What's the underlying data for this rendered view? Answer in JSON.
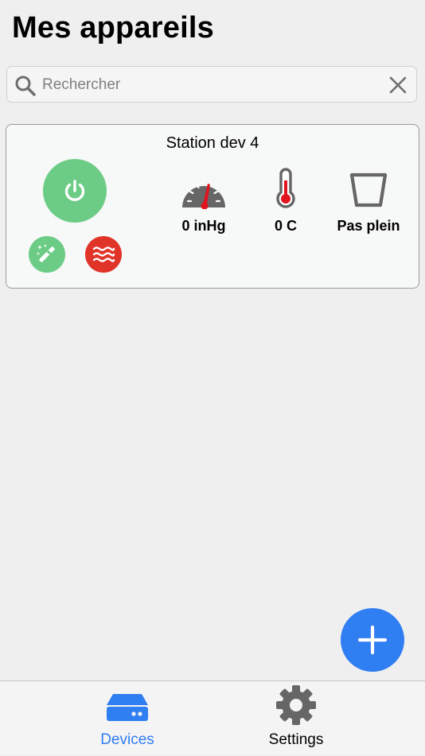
{
  "header": {
    "title": "Mes appareils"
  },
  "search": {
    "placeholder": "Rechercher",
    "value": "",
    "search_icon": "search-icon",
    "clear_icon": "close-icon"
  },
  "devices": [
    {
      "name": "Station dev 4",
      "power_icon": "power-icon",
      "actions": [
        {
          "icon": "magic-wand-icon",
          "color": "#6ccc86"
        },
        {
          "icon": "heat-waves-icon",
          "color": "#e03428"
        }
      ],
      "metrics": [
        {
          "icon": "gauge-icon",
          "label": "0 inHg"
        },
        {
          "icon": "thermometer-icon",
          "label": "0 C"
        },
        {
          "icon": "bucket-icon",
          "label": "Pas plein"
        }
      ]
    }
  ],
  "fab": {
    "icon": "plus-icon",
    "color": "#2f7ef2"
  },
  "tabs": [
    {
      "label": "Devices",
      "icon": "server-icon",
      "active": true
    },
    {
      "label": "Settings",
      "icon": "gear-icon",
      "active": false
    }
  ],
  "colors": {
    "accent": "#2f7ef2",
    "power_on": "#6ccc86",
    "heat": "#e03428",
    "needle": "#e0141e"
  }
}
